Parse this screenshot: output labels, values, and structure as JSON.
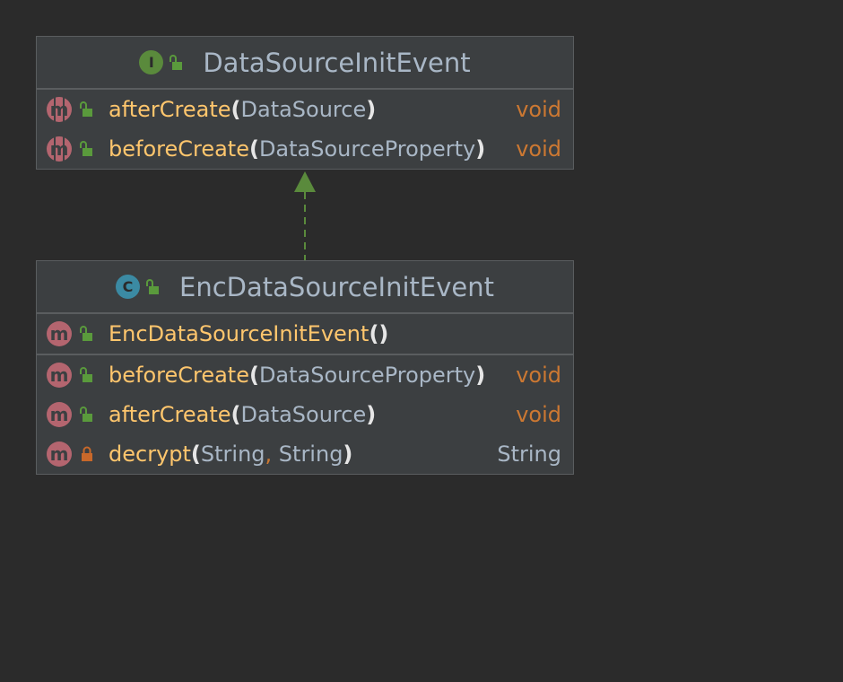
{
  "diagram": {
    "interface": {
      "kind_letter": "I",
      "kind_icon": "interface-icon",
      "name": "DataSourceInitEvent",
      "methods": [
        {
          "name": "afterCreate",
          "open": "(",
          "params": "DataSource",
          "close": ")",
          "returns": "void",
          "visibility": "public",
          "abstract": true
        },
        {
          "name": "beforeCreate",
          "open": "(",
          "params": "DataSourceProperty",
          "close": ")",
          "returns": "void",
          "visibility": "public",
          "abstract": true
        }
      ]
    },
    "class": {
      "kind_letter": "C",
      "kind_icon": "class-icon",
      "name": "EncDataSourceInitEvent",
      "constructors": [
        {
          "name": "EncDataSourceInitEvent",
          "open": "(",
          "close": ")",
          "visibility": "public"
        }
      ],
      "methods": [
        {
          "name": "beforeCreate",
          "open": "(",
          "params": "DataSourceProperty",
          "close": ")",
          "returns": "void",
          "visibility": "public"
        },
        {
          "name": "afterCreate",
          "open": "(",
          "params": "DataSource",
          "close": ")",
          "returns": "void",
          "visibility": "public"
        },
        {
          "name": "decrypt",
          "open": "(",
          "param1": "String",
          "comma": ",",
          "param2": "String",
          "close": ")",
          "returns": "String",
          "visibility": "private"
        }
      ]
    },
    "method_letter": "m",
    "relation": "implements",
    "colors": {
      "background": "#2b2b2b",
      "box": "#3c3f41",
      "border": "#5a5d5f",
      "method_name": "#ffc66d",
      "keyword": "#cc7832",
      "type": "#a9b7c6",
      "method_icon": "#b4656f",
      "interface_icon": "#5a8a3c",
      "class_icon": "#3b8aa3",
      "public_lock": "#5a9a3c",
      "private_lock": "#c8682a",
      "arrow": "#5a8a3c"
    }
  }
}
